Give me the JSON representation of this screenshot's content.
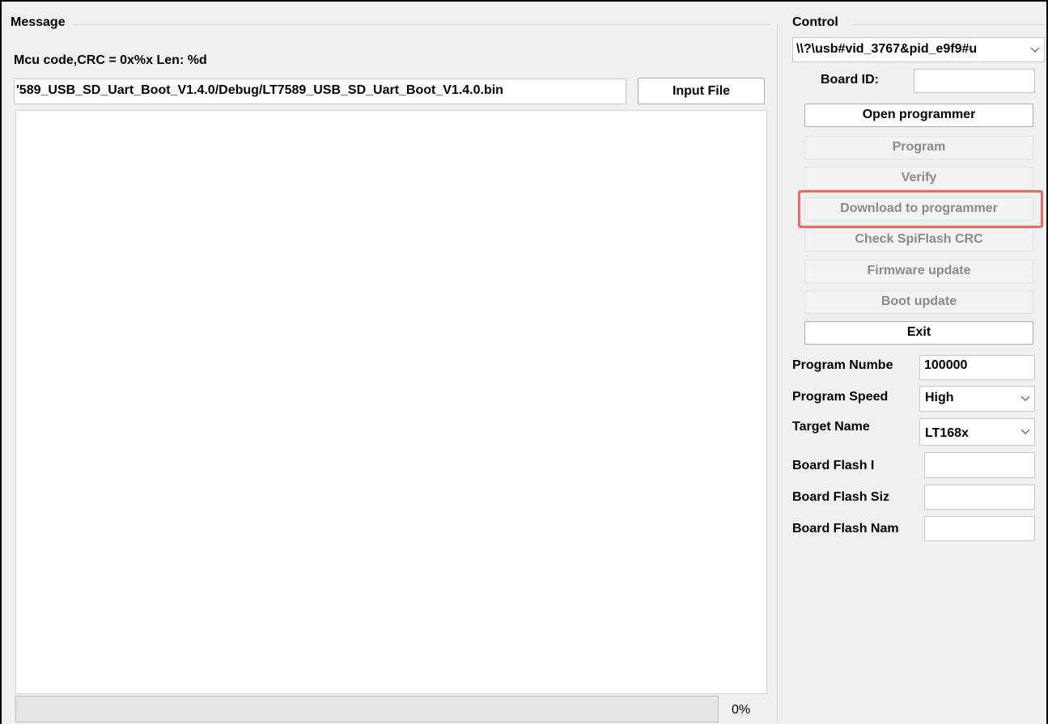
{
  "message": {
    "group_title": "Message",
    "crc_label": "Mcu code,CRC = 0x%x  Len: %d",
    "file_path": "'589_USB_SD_Uart_Boot_V1.4.0/Debug/LT7589_USB_SD_Uart_Boot_V1.4.0.bin",
    "input_file_label": "Input File",
    "log_text": "",
    "progress_value": 0,
    "progress_text": "0%"
  },
  "control": {
    "group_title": "Control",
    "device_selected": "\\\\?\\usb#vid_3767&pid_e9f9#u",
    "board_id_label": "Board ID:",
    "board_id_value": "",
    "buttons": {
      "open_programmer": "Open programmer",
      "program": "Program",
      "verify": "Verify",
      "download_to_programmer": "Download to programmer",
      "check_spiflash_crc": "Check SpiFlash CRC",
      "firmware_update": "Firmware update",
      "boot_update": "Boot update",
      "exit": "Exit"
    },
    "program_number_label": "Program Numbe",
    "program_number_value": "100000",
    "program_speed_label": "Program Speed",
    "program_speed_value": "High",
    "target_name_label": "Target Name",
    "target_name_value": "LT168x",
    "board_flash_id_label": "Board Flash I",
    "board_flash_id_value": "",
    "board_flash_size_label": "Board Flash Siz",
    "board_flash_size_value": "",
    "board_flash_name_label": "Board Flash Nam",
    "board_flash_name_value": ""
  },
  "colors": {
    "highlight": "#e86b67",
    "disabled_text": "#8a8a8a",
    "progress_fill": "#06b025"
  },
  "icons": {
    "dropdown": "chevron-down-icon"
  }
}
